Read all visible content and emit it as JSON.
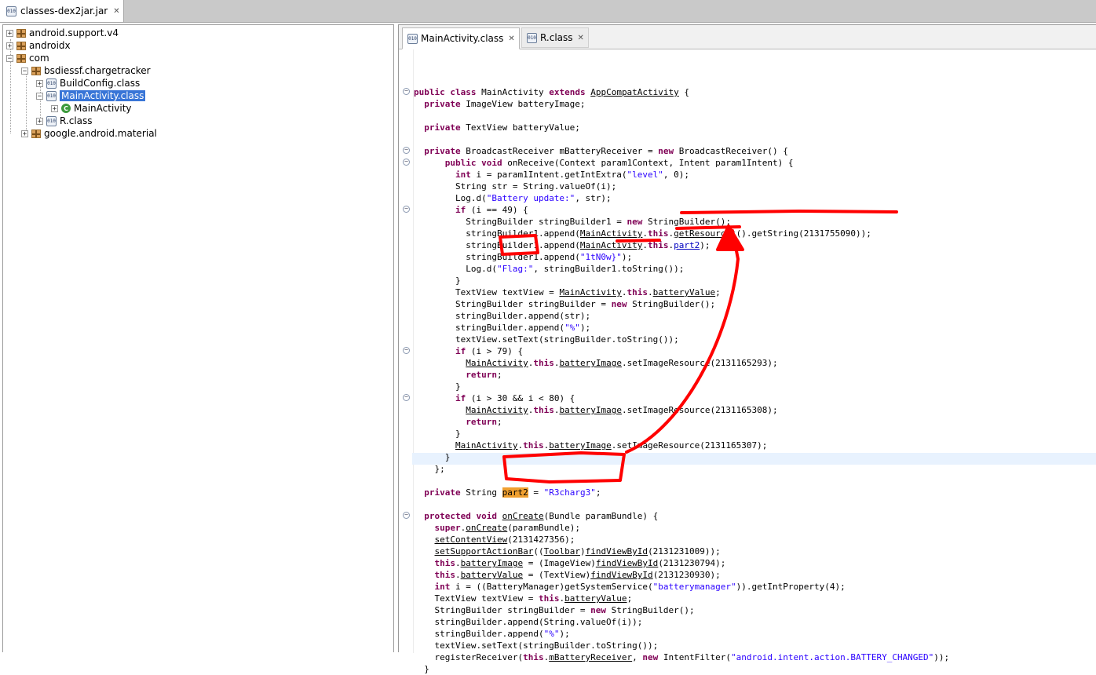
{
  "top_tab": {
    "label": "classes-dex2jar.jar",
    "icon": "jar-file-icon"
  },
  "tree": [
    {
      "label": "android.support.v4",
      "icon": "package-icon"
    },
    {
      "label": "androidx",
      "icon": "package-icon"
    },
    {
      "label": "com",
      "icon": "package-icon"
    },
    {
      "label": "bsdiessf.chargetracker",
      "icon": "package-icon"
    },
    {
      "label": "BuildConfig.class",
      "icon": "class-file-icon"
    },
    {
      "label": "MainActivity.class",
      "icon": "class-file-icon",
      "selected": true
    },
    {
      "label": "MainActivity",
      "icon": "class-icon"
    },
    {
      "label": "R.class",
      "icon": "class-file-icon"
    },
    {
      "label": "google.android.material",
      "icon": "package-icon"
    }
  ],
  "editor_tabs": [
    {
      "label": "MainActivity.class",
      "active": true
    },
    {
      "label": "R.class",
      "active": false
    }
  ],
  "code_lines": [
    "public class MainActivity extends AppCompatActivity {",
    "  private ImageView batteryImage;",
    "",
    "  private TextView batteryValue;",
    "",
    "  private BroadcastReceiver mBatteryReceiver = new BroadcastReceiver() {",
    "      public void onReceive(Context param1Context, Intent param1Intent) {",
    "        int i = param1Intent.getIntExtra(\"level\", 0);",
    "        String str = String.valueOf(i);",
    "        Log.d(\"Battery update:\", str);",
    "        if (i == 49) {",
    "          StringBuilder stringBuilder1 = new StringBuilder();",
    "          stringBuilder1.append(MainActivity.this.getResources().getString(2131755090));",
    "          stringBuilder1.append(MainActivity.this.part2);",
    "          stringBuilder1.append(\"1tN0w}\");",
    "          Log.d(\"Flag:\", stringBuilder1.toString());",
    "        }",
    "        TextView textView = MainActivity.this.batteryValue;",
    "        StringBuilder stringBuilder = new StringBuilder();",
    "        stringBuilder.append(str);",
    "        stringBuilder.append(\"%\");",
    "        textView.setText(stringBuilder.toString());",
    "        if (i > 79) {",
    "          MainActivity.this.batteryImage.setImageResource(2131165293);",
    "          return;",
    "        }",
    "        if (i > 30 && i < 80) {",
    "          MainActivity.this.batteryImage.setImageResource(2131165308);",
    "          return;",
    "        }",
    "        MainActivity.this.batteryImage.setImageResource(2131165307);",
    "      }",
    "    };",
    "",
    "  private String part2 = \"R3charg3\";",
    "",
    "  protected void onCreate(Bundle paramBundle) {",
    "    super.onCreate(paramBundle);",
    "    setContentView(2131427356);",
    "    setSupportActionBar((Toolbar)findViewById(2131231009));",
    "    this.batteryImage = (ImageView)findViewById(2131230794);",
    "    this.batteryValue = (TextView)findViewById(2131230930);",
    "    int i = ((BatteryManager)getSystemService(\"batterymanager\")).getIntProperty(4);",
    "    TextView textView = this.batteryValue;",
    "    StringBuilder stringBuilder = new StringBuilder();",
    "    stringBuilder.append(String.valueOf(i));",
    "    stringBuilder.append(\"%\");",
    "    textView.setText(stringBuilder.toString());",
    "    registerReceiver(this.mBatteryReceiver, new IntentFilter(\"android.intent.action.BATTERY_CHANGED\"));",
    "  }"
  ],
  "highlighted_identifier": "part2",
  "annotation_color": "#ff0000"
}
